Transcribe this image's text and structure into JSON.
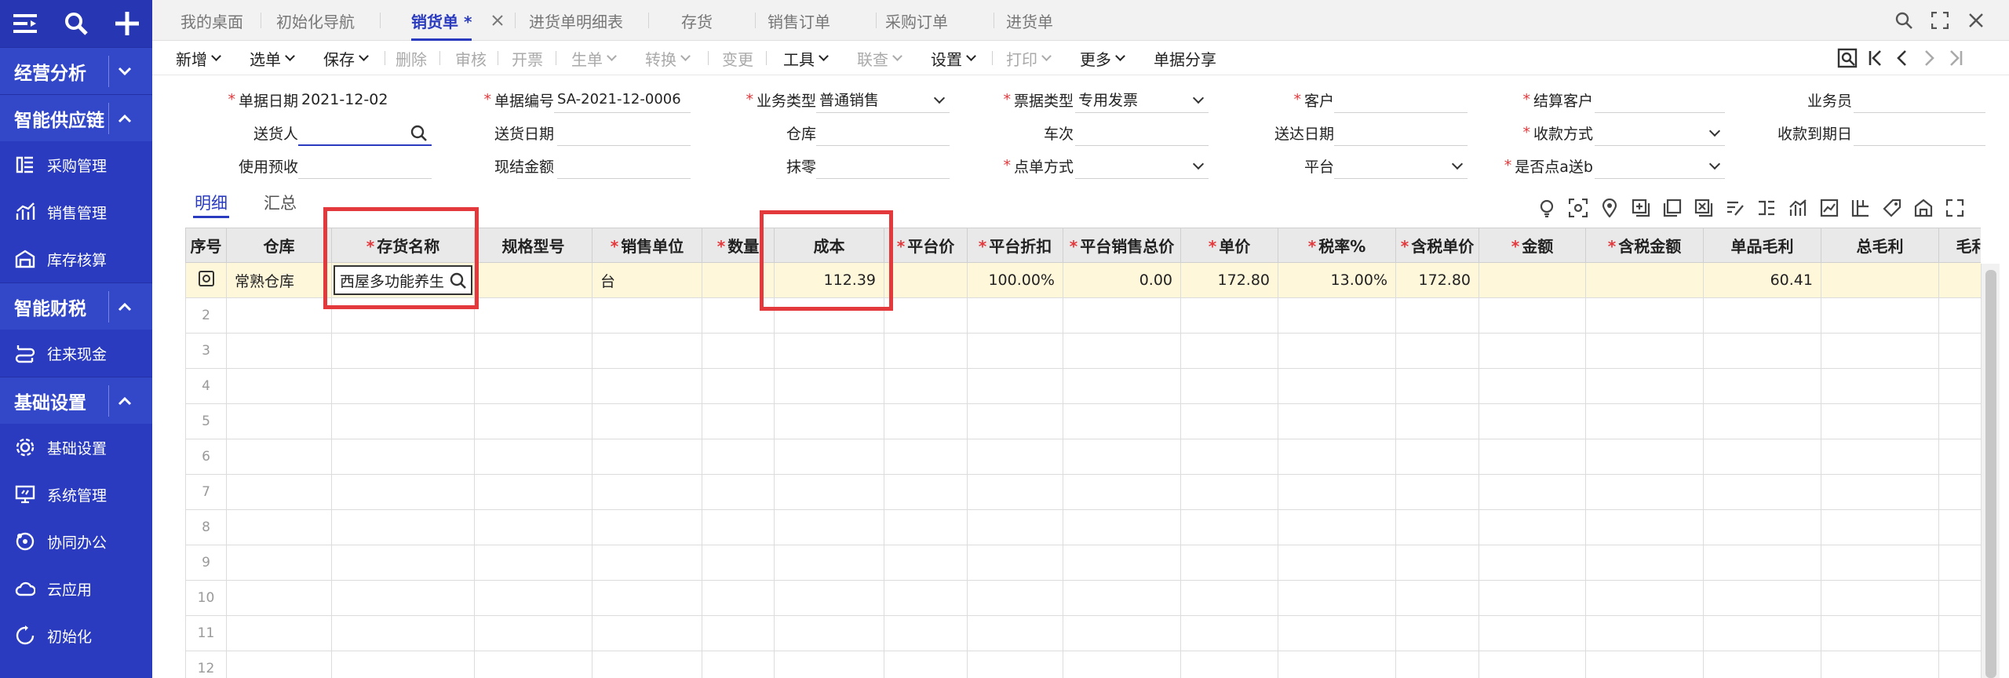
{
  "sidebar": {
    "sections": [
      {
        "label": "经营分析",
        "items": []
      },
      {
        "label": "智能供应链",
        "items": [
          "采购管理",
          "销售管理",
          "库存核算"
        ]
      },
      {
        "label": "智能财税",
        "items": [
          "往来现金"
        ]
      },
      {
        "label": "基础设置",
        "items": [
          "基础设置",
          "系统管理",
          "协同办公",
          "云应用",
          "初始化"
        ]
      }
    ]
  },
  "tabs": [
    "我的桌面",
    "初始化导航",
    "销货单 *",
    "进货单明细表",
    "存货",
    "销售订单",
    "采购订单",
    "进货单"
  ],
  "active_tab": 2,
  "toolbar": {
    "buttons": [
      "新增",
      "选单",
      "保存",
      "删除",
      "审核",
      "开票",
      "生单",
      "转换",
      "变更",
      "工具",
      "联查",
      "设置",
      "打印",
      "更多",
      "单据分享"
    ]
  },
  "form": {
    "row1": [
      {
        "label": "单据日期",
        "req": true,
        "value": "2021-12-02"
      },
      {
        "label": "单据编号",
        "req": true,
        "value": "SA-2021-12-0006"
      },
      {
        "label": "业务类型",
        "req": true,
        "value": "普通销售"
      },
      {
        "label": "票据类型",
        "req": true,
        "value": "专用发票"
      },
      {
        "label": "客户",
        "req": true,
        "value": ""
      },
      {
        "label": "结算客户",
        "req": true,
        "value": ""
      },
      {
        "label": "业务员",
        "req": false,
        "value": ""
      }
    ],
    "row2": [
      {
        "label": "送货人",
        "value": ""
      },
      {
        "label": "送货日期",
        "value": ""
      },
      {
        "label": "仓库",
        "value": ""
      },
      {
        "label": "车次",
        "value": ""
      },
      {
        "label": "送达日期",
        "value": ""
      },
      {
        "label": "收款方式",
        "req": true,
        "value": ""
      },
      {
        "label": "收款到期日",
        "value": ""
      }
    ],
    "row3": [
      {
        "label": "使用预收",
        "value": ""
      },
      {
        "label": "现结金额",
        "value": ""
      },
      {
        "label": "抹零",
        "value": ""
      },
      {
        "label": "点单方式",
        "req": true,
        "value": ""
      },
      {
        "label": "平台",
        "value": ""
      },
      {
        "label": "是否点a送b",
        "req": true,
        "value": ""
      }
    ]
  },
  "subtabs": [
    "明细",
    "汇总"
  ],
  "grid": {
    "headers": [
      "序号",
      "仓库",
      "存货名称",
      "规格型号",
      "销售单位",
      "数量",
      "成本",
      "平台价",
      "平台折扣",
      "平台销售总价",
      "单价",
      "税率%",
      "含税单价",
      "金额",
      "含税金额",
      "单品毛利",
      "总毛利",
      "毛利率"
    ],
    "row1": {
      "warehouse": "常熟仓库",
      "item": "西屋多功能养生",
      "spec": "",
      "unit": "台",
      "qty": "",
      "cost": "112.39",
      "plat_price": "",
      "plat_disc": "100.00%",
      "plat_total": "0.00",
      "price": "172.80",
      "tax": "13.00%",
      "tax_price": "172.80",
      "amount": "",
      "tax_amount": "",
      "unit_profit": "60.41",
      "total_profit": "",
      "margin": ""
    },
    "row_numbers": [
      "2",
      "3",
      "4",
      "5",
      "6",
      "7",
      "8",
      "9",
      "10",
      "11",
      "12"
    ]
  }
}
